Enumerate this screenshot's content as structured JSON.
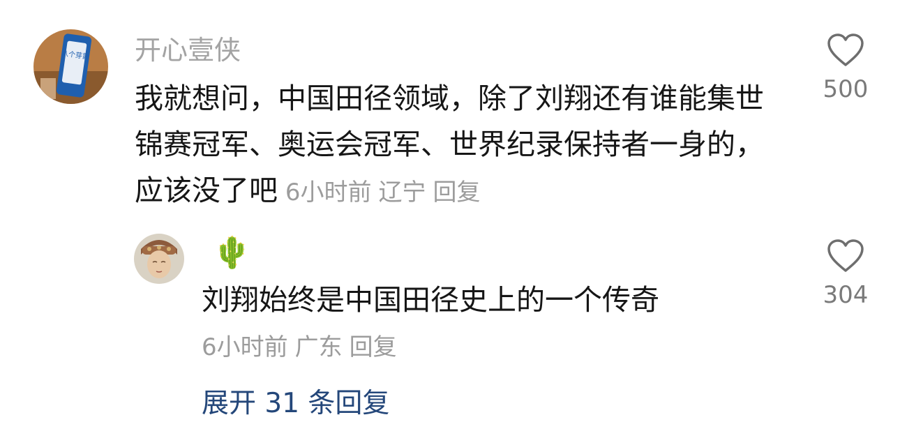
{
  "comment": {
    "username": "开心壹侠",
    "text": "我就想问，中国田径领域，除了刘翔还有谁能集世锦赛冠军、奥运会冠军、世界纪录保持者一身的，应该没了吧",
    "time": "6小时前",
    "location": "辽宁",
    "reply_label": "回复",
    "likes": "500",
    "avatar_caption": "八个芽露"
  },
  "reply": {
    "username": "🌵",
    "text": "刘翔始终是中国田径史上的一个传奇",
    "time": "6小时前",
    "location": "广东",
    "reply_label": "回复",
    "likes": "304"
  },
  "expand_label": "展开 31 条回复",
  "colors": {
    "meta_gray": "#9c9c9c",
    "link_blue": "#24477a",
    "text_dark": "#161616"
  }
}
